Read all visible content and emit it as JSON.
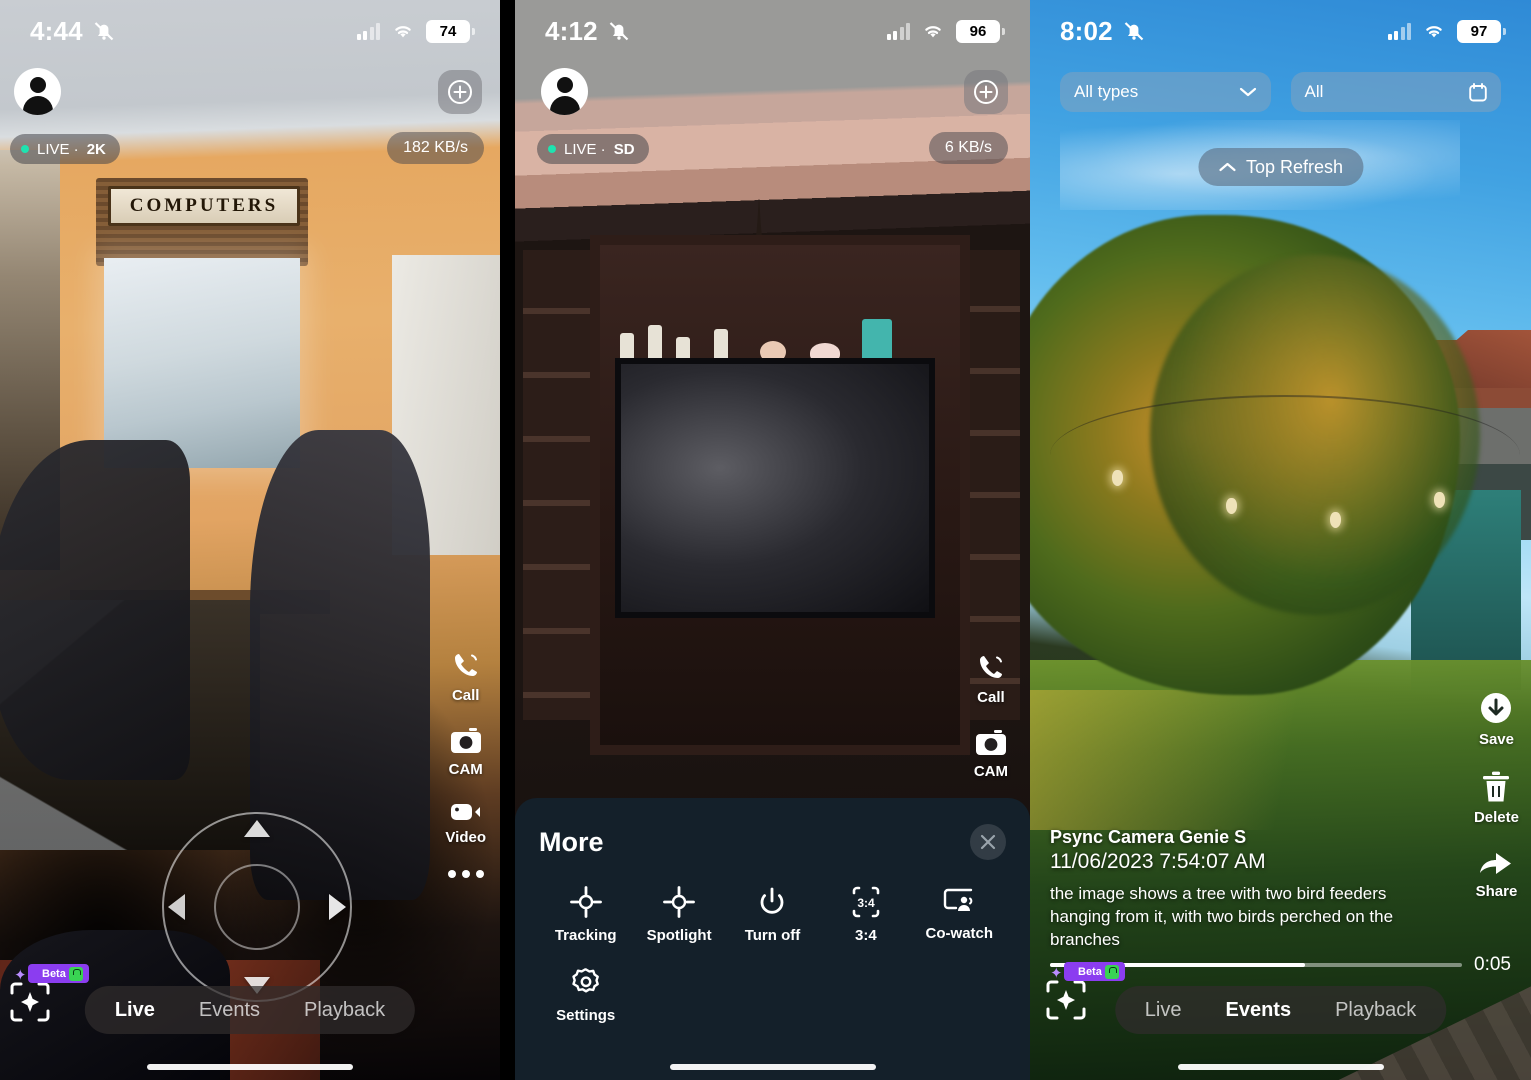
{
  "panel1": {
    "status": {
      "time": "4:44",
      "battery": "74",
      "silent_icon": "bell-slash-icon",
      "wifi_icon": "wifi-icon",
      "cellular_icon": "cellular-bars-icon"
    },
    "live_badge": {
      "prefix": "LIVE ·",
      "quality": "2K"
    },
    "bitrate": "182 KB/s",
    "add_button": "plus-circle-icon",
    "side_actions": [
      {
        "icon": "phone-call-icon",
        "label": "Call"
      },
      {
        "icon": "camera-icon",
        "label": "CAM"
      },
      {
        "icon": "video-camera-icon",
        "label": "Video"
      },
      {
        "icon": "more-dots-icon",
        "label": ""
      }
    ],
    "tabs": [
      {
        "label": "Live",
        "active": true
      },
      {
        "label": "Events",
        "active": false
      },
      {
        "label": "Playback",
        "active": false
      }
    ],
    "ai_badge": {
      "label": "Beta",
      "icon": "ai-sparkle-icon",
      "lock": "lock-icon"
    },
    "sign_text": "COMPUTERS"
  },
  "panel2": {
    "status": {
      "time": "4:12",
      "battery": "96"
    },
    "live_badge": {
      "prefix": "LIVE ·",
      "quality": "SD"
    },
    "bitrate": "6 KB/s",
    "side_actions": [
      {
        "icon": "phone-call-icon",
        "label": "Call"
      },
      {
        "icon": "camera-icon",
        "label": "CAM"
      }
    ],
    "sheet": {
      "title": "More",
      "close_icon": "close-icon",
      "items": [
        {
          "icon": "tracking-target-icon",
          "label": "Tracking"
        },
        {
          "icon": "spotlight-target-icon",
          "label": "Spotlight"
        },
        {
          "icon": "power-icon",
          "label": "Turn off"
        },
        {
          "icon": "aspect-ratio-icon",
          "label": "3:4"
        },
        {
          "icon": "co-watch-icon",
          "label": "Co-watch"
        },
        {
          "icon": "settings-gear-icon",
          "label": "Settings"
        }
      ]
    }
  },
  "panel3": {
    "status": {
      "time": "8:02",
      "battery": "97"
    },
    "filters": [
      {
        "label": "All types",
        "icon": "chevron-down-icon"
      },
      {
        "label": "All",
        "icon": "calendar-icon"
      }
    ],
    "refresh": {
      "label": "Top Refresh",
      "icon": "chevron-up-icon"
    },
    "event": {
      "camera_name": "Psync Camera Genie S",
      "timestamp": "11/06/2023 7:54:07 AM",
      "description": "the image shows a tree with two bird feeders hanging from it, with two birds perched on the branches"
    },
    "actions": [
      {
        "icon": "download-save-icon",
        "label": "Save"
      },
      {
        "icon": "trash-delete-icon",
        "label": "Delete"
      },
      {
        "icon": "share-arrow-icon",
        "label": "Share"
      }
    ],
    "timeline": {
      "duration": "0:05",
      "progress_percent": 62
    },
    "tabs": [
      {
        "label": "Live",
        "active": false
      },
      {
        "label": "Events",
        "active": true
      },
      {
        "label": "Playback",
        "active": false
      }
    ],
    "ai_badge": {
      "label": "Beta"
    }
  },
  "colors": {
    "accent_live": "#1fe3b0",
    "sheet_bg": "#14202a",
    "beta_purple": "#8b3df0",
    "lock_green": "#39d353"
  }
}
